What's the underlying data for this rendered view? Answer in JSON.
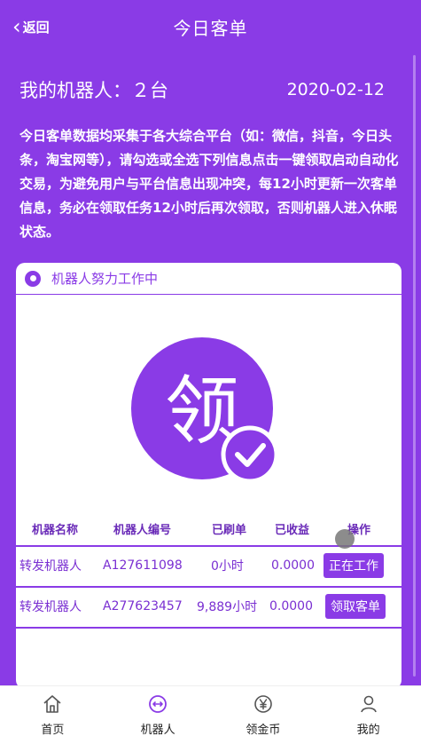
{
  "header": {
    "back_label": "返回",
    "title": "今日客单"
  },
  "summary": {
    "robots_text": "我的机器人：２台",
    "date": "2020-02-12"
  },
  "notice": "今日客单数据均采集于各大综合平台（如：微信，抖音，今日头条，淘宝网等），请勾选或全选下列信息点击一键领取启动自动化交易，为避免用户与平台信息出现冲突，每12小时更新一次客单信息，务必在领取任务12小时后再次领取，否则机器人进入休眠状态。",
  "card": {
    "status_text": "机器人努力工作中",
    "badge_char": "领",
    "columns": [
      "机器名称",
      "机器人编号",
      "已刷单",
      "已收益",
      "操作"
    ],
    "rows": [
      {
        "name": "转发机器人",
        "id": "A127611098",
        "orders": "0小时",
        "earnings": "0.0000",
        "action": "正在工作"
      },
      {
        "name": "转发机器人",
        "id": "A277623457",
        "orders": "9,889小时",
        "earnings": "0.0000",
        "action": "领取客单"
      }
    ]
  },
  "tabbar": {
    "items": [
      {
        "label": "首页",
        "icon": "home-icon"
      },
      {
        "label": "机器人",
        "icon": "robot-icon"
      },
      {
        "label": "领金币",
        "icon": "yen-coin-icon"
      },
      {
        "label": "我的",
        "icon": "user-icon"
      }
    ]
  },
  "colors": {
    "primary": "#8a3be6",
    "white": "#ffffff"
  }
}
